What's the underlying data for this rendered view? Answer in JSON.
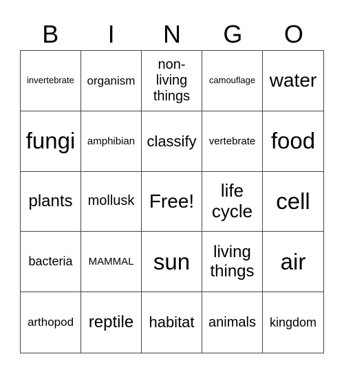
{
  "header": {
    "letters": [
      "B",
      "I",
      "N",
      "G",
      "O"
    ]
  },
  "board": {
    "rows": [
      [
        "invertebrate",
        "organism",
        "non-\nliving\nthings",
        "camouflage",
        "water"
      ],
      [
        "fungi",
        "amphibian",
        "classify",
        "vertebrate",
        "food"
      ],
      [
        "plants",
        "mollusk",
        "Free!",
        "life\ncycle",
        "cell"
      ],
      [
        "bacteria",
        "MAMMAL",
        "sun",
        "living\nthings",
        "air"
      ],
      [
        "arthopod",
        "reptile",
        "habitat",
        "animals",
        "kingdom"
      ]
    ]
  }
}
